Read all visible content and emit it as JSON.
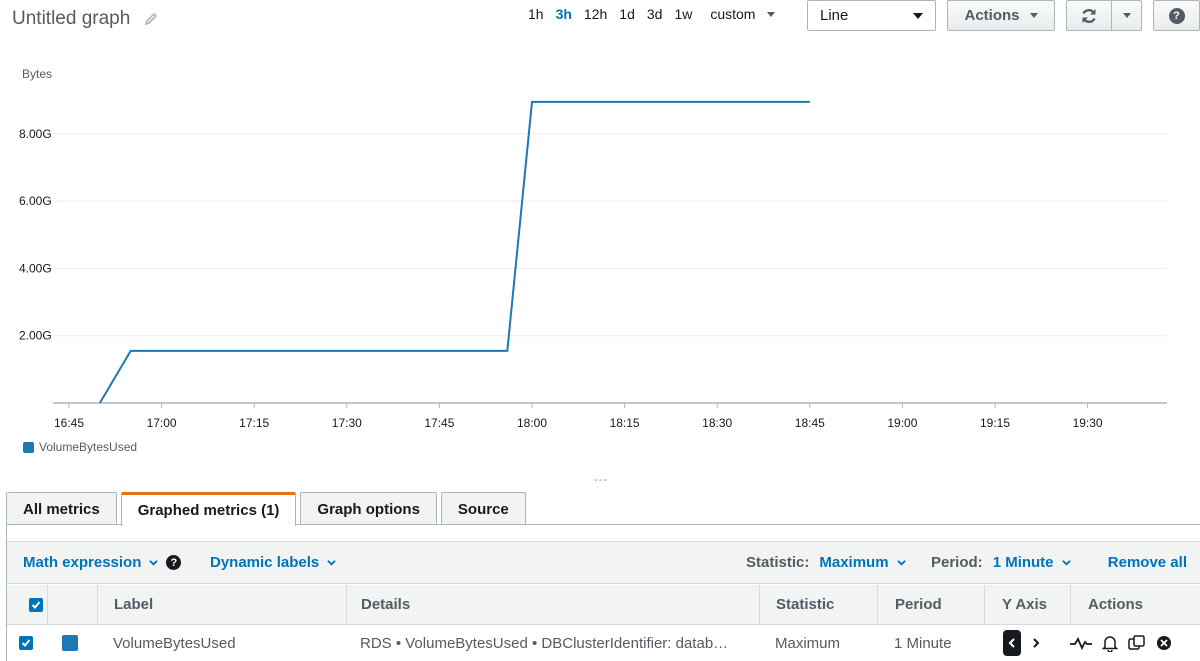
{
  "header": {
    "title": "Untitled graph",
    "time_ranges": [
      "1h",
      "3h",
      "12h",
      "1d",
      "3d",
      "1w"
    ],
    "active_range": "3h",
    "custom_label": "custom",
    "graph_type": "Line",
    "actions_label": "Actions"
  },
  "chart_data": {
    "type": "line",
    "ylabel": "Bytes",
    "x_ticks": [
      "16:45",
      "17:00",
      "17:15",
      "17:30",
      "17:45",
      "18:00",
      "18:15",
      "18:30",
      "18:45",
      "19:00",
      "19:15",
      "19:30"
    ],
    "y_ticks": [
      "2.00G",
      "4.00G",
      "6.00G",
      "8.00G"
    ],
    "y_tick_values": [
      2,
      4,
      6,
      8
    ],
    "ylim": [
      0,
      9.9
    ],
    "x_range": [
      "16:45",
      "19:35"
    ],
    "grid": true,
    "series": [
      {
        "name": "VolumeBytesUsed",
        "color": "#1f77b4",
        "x": [
          "16:50",
          "16:55",
          "17:56",
          "18:00",
          "18:45"
        ],
        "y": [
          0,
          1.55,
          1.55,
          8.95,
          8.95
        ]
      }
    ]
  },
  "legend": {
    "label": "VolumeBytesUsed"
  },
  "tabs": [
    {
      "label": "All metrics",
      "active": false
    },
    {
      "label": "Graphed metrics (1)",
      "active": true
    },
    {
      "label": "Graph options",
      "active": false
    },
    {
      "label": "Source",
      "active": false
    }
  ],
  "toolbar": {
    "math_expression": "Math expression",
    "dynamic_labels": "Dynamic labels",
    "statistic_label": "Statistic:",
    "statistic_value": "Maximum",
    "period_label": "Period:",
    "period_value": "1 Minute",
    "remove_all": "Remove all"
  },
  "table": {
    "columns": [
      "Label",
      "Details",
      "Statistic",
      "Period",
      "Y Axis",
      "Actions"
    ],
    "rows": [
      {
        "label": "VolumeBytesUsed",
        "details": "RDS • VolumeBytesUsed • DBClusterIdentifier: datab…",
        "statistic": "Maximum",
        "period": "1 Minute",
        "color": "#1f77b4"
      }
    ]
  }
}
